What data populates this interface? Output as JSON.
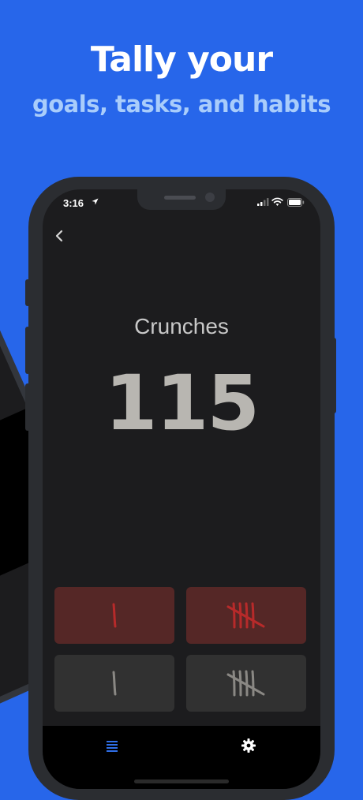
{
  "promo": {
    "headline": "Tally your",
    "subline": "goals, tasks, and habits"
  },
  "status_bar": {
    "time": "3:16"
  },
  "counter": {
    "name": "Crunches",
    "value": "115"
  },
  "buttons": [
    {
      "name": "decrement-1",
      "icon": "tally-one-icon"
    },
    {
      "name": "decrement-5",
      "icon": "tally-five-icon"
    },
    {
      "name": "increment-1",
      "icon": "tally-one-icon"
    },
    {
      "name": "increment-5",
      "icon": "tally-five-icon"
    }
  ],
  "tab_bar": {
    "tabs": [
      {
        "icon": "list-icon",
        "active": true
      },
      {
        "icon": "gear-icon",
        "active": false
      }
    ]
  },
  "colors": {
    "background": "#2766ea",
    "headline": "#ffffff",
    "subline": "#a9cdfb",
    "decrement_button": "#552726",
    "decrement_mark": "#b72a2a",
    "increment_button": "#313131",
    "increment_mark": "#8a8884",
    "active_tab": "#2f6fe8"
  }
}
